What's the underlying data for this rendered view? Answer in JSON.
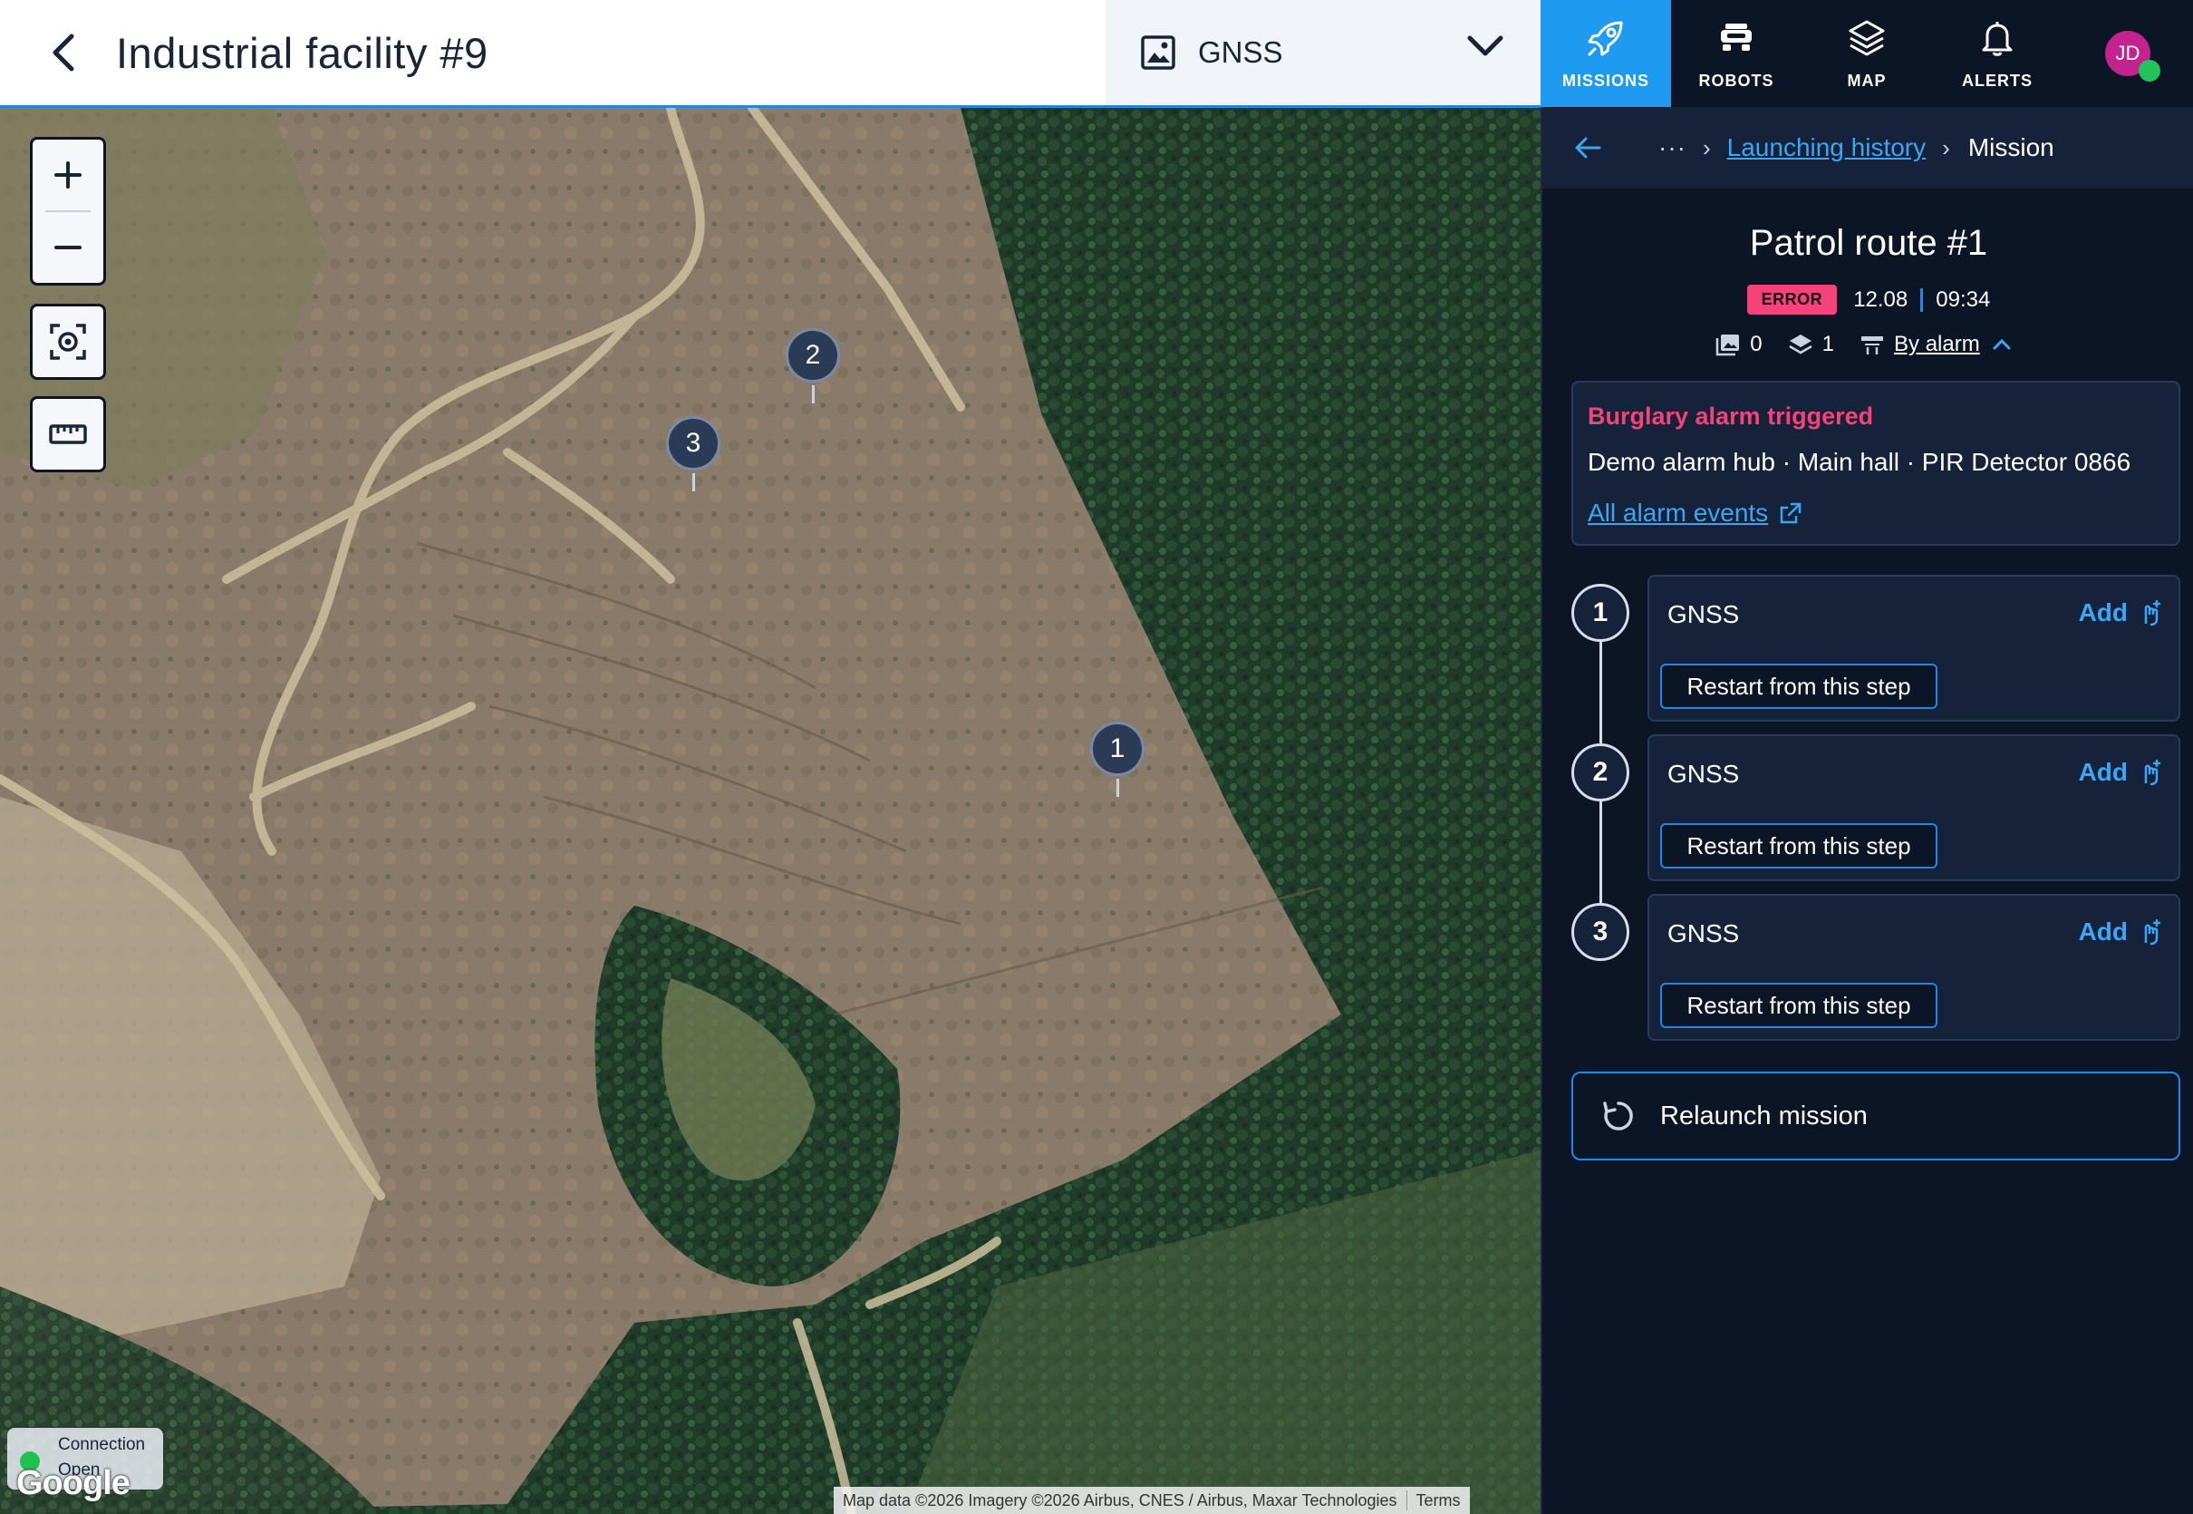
{
  "header": {
    "title": "Industrial facility #9",
    "layer_select": {
      "value": "GNSS"
    }
  },
  "nav": {
    "items": [
      {
        "label": "MISSIONS",
        "icon": "rocket-icon",
        "active": true
      },
      {
        "label": "ROBOTS",
        "icon": "robot-icon",
        "active": false
      },
      {
        "label": "MAP",
        "icon": "layers-icon",
        "active": false
      },
      {
        "label": "ALERTS",
        "icon": "bell-icon",
        "active": false
      }
    ],
    "avatar": {
      "initials": "JD",
      "online_color": "#21c45a"
    }
  },
  "map": {
    "markers": [
      {
        "label": "1"
      },
      {
        "label": "2"
      },
      {
        "label": "3"
      }
    ],
    "connection": {
      "label": "Connection",
      "state": "Open"
    },
    "provider": "Google",
    "attribution": "Map data ©2026 Imagery ©2026 Airbus, CNES / Airbus, Maxar Technologies",
    "terms": "Terms"
  },
  "panel": {
    "breadcrumb": {
      "ellipsis": "···",
      "link": "Launching history",
      "current": "Mission"
    },
    "mission": {
      "title": "Patrol route #1",
      "status": "ERROR",
      "date": "12.08",
      "time": "09:34",
      "images_count": "0",
      "layers_count": "1",
      "trigger": "By alarm"
    },
    "alarm": {
      "title": "Burglary alarm triggered",
      "description": "Demo alarm hub · Main hall · PIR Detector 0866",
      "link": "All alarm events"
    },
    "steps": [
      {
        "number": "1",
        "name": "GNSS",
        "add_label": "Add",
        "restart_label": "Restart from this step"
      },
      {
        "number": "2",
        "name": "GNSS",
        "add_label": "Add",
        "restart_label": "Restart from this step"
      },
      {
        "number": "3",
        "name": "GNSS",
        "add_label": "Add",
        "restart_label": "Restart from this step"
      }
    ],
    "relaunch_label": "Relaunch mission"
  },
  "colors": {
    "accent": "#1e9bf0",
    "error": "#f5437a",
    "panel_bg": "#0c1526",
    "card_bg": "#16223a",
    "link": "#3aa6f5"
  }
}
